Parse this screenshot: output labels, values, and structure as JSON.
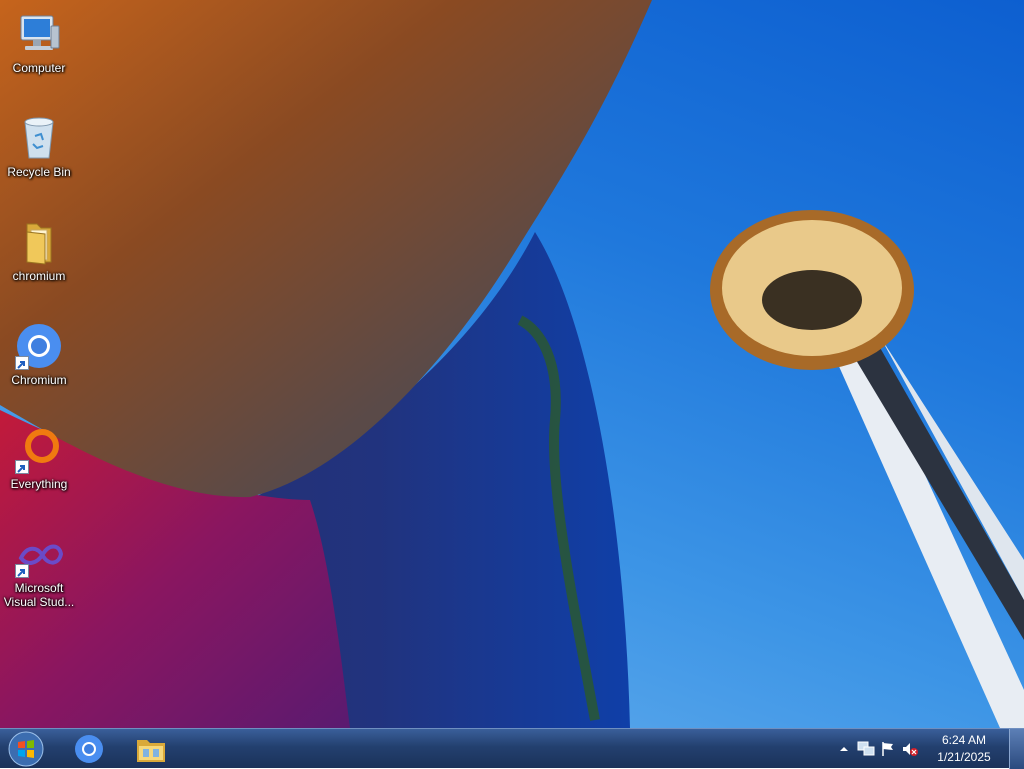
{
  "desktop": {
    "icons": [
      {
        "label": "Computer",
        "icon": "computer-icon"
      },
      {
        "label": "Recycle Bin",
        "icon": "recycle-bin-icon"
      },
      {
        "label": "chromium",
        "icon": "folder-icon"
      },
      {
        "label": "Chromium",
        "icon": "chromium-icon",
        "shortcut": true
      },
      {
        "label": "Everything",
        "icon": "everything-icon",
        "shortcut": true
      },
      {
        "label": "Microsoft Visual Stud...",
        "icon": "visual-studio-icon",
        "shortcut": true
      }
    ]
  },
  "taskbar": {
    "start_icon": "windows-start-icon",
    "pinned": [
      {
        "name": "chromium",
        "icon": "chromium-icon"
      },
      {
        "name": "file-explorer",
        "icon": "file-explorer-icon"
      }
    ],
    "tray": {
      "icons": [
        "show-hidden-icons-icon",
        "network-icon",
        "action-center-flag-icon",
        "volume-muted-icon"
      ],
      "time": "6:24 AM",
      "date": "1/21/2025"
    }
  },
  "colors": {
    "taskbar": "#23406f",
    "sky": "#1f78dc",
    "chromium_blue": "#4a8ef0",
    "everything_orange": "#f07a10"
  }
}
